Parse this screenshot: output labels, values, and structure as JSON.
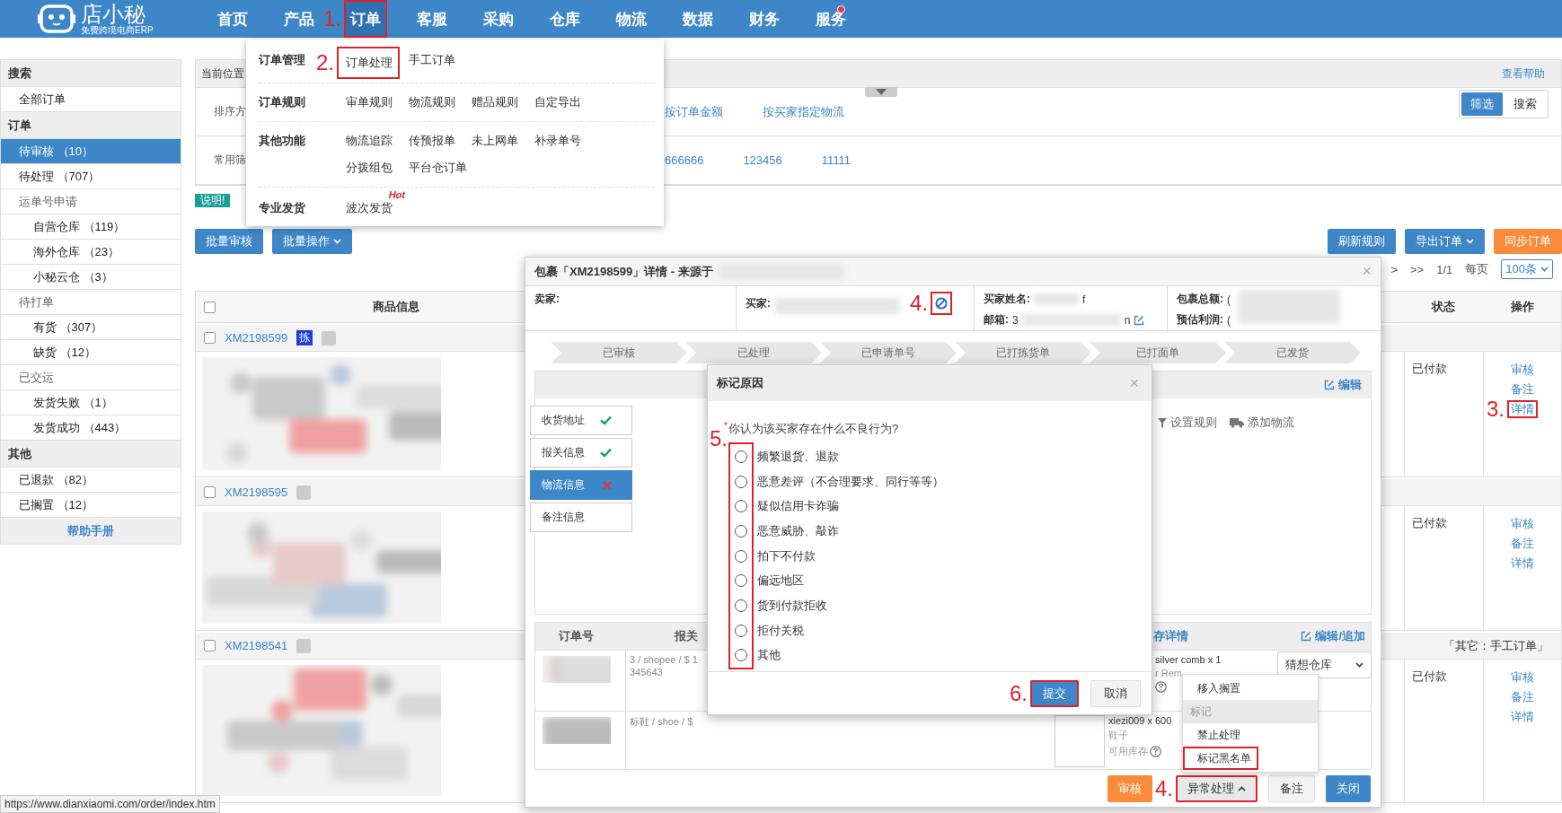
{
  "header": {
    "logo": "店小秘",
    "tagline": "免费跨境电商ERP",
    "nav": [
      {
        "label": "首页",
        "selected": false,
        "notice": false,
        "highlighted": false
      },
      {
        "label": "产品",
        "selected": false,
        "notice": false,
        "highlighted": false
      },
      {
        "label": "订单",
        "selected": true,
        "notice": false,
        "highlighted": true,
        "annotation": "1."
      },
      {
        "label": "客服",
        "selected": false,
        "notice": false,
        "highlighted": false
      },
      {
        "label": "采购",
        "selected": false,
        "notice": false,
        "highlighted": false
      },
      {
        "label": "仓库",
        "selected": false,
        "notice": false,
        "highlighted": false
      },
      {
        "label": "物流",
        "selected": false,
        "notice": false,
        "highlighted": false
      },
      {
        "label": "数据",
        "selected": false,
        "notice": false,
        "highlighted": false
      },
      {
        "label": "财务",
        "selected": false,
        "notice": false,
        "highlighted": false
      },
      {
        "label": "服务",
        "selected": false,
        "notice": true,
        "highlighted": false
      }
    ]
  },
  "order_menu": {
    "groups": [
      {
        "title": "订单管理",
        "links": [
          {
            "label": "订单处理",
            "highlighted": true,
            "annotation": "2."
          },
          {
            "label": "手工订单",
            "highlighted": false
          }
        ]
      },
      {
        "title": "订单规则",
        "links": [
          {
            "label": "审单规则",
            "highlighted": false
          },
          {
            "label": "物流规则",
            "highlighted": false
          },
          {
            "label": "赠品规则",
            "highlighted": false
          },
          {
            "label": "自定导出",
            "highlighted": false
          }
        ]
      },
      {
        "title": "其他功能",
        "links": [
          {
            "label": "物流追踪",
            "highlighted": false
          },
          {
            "label": "传预报单",
            "highlighted": false
          },
          {
            "label": "未上网单",
            "highlighted": false
          },
          {
            "label": "补录单号",
            "highlighted": false
          },
          {
            "label": "分拨组包",
            "highlighted": false
          },
          {
            "label": "平台仓订单",
            "highlighted": false
          }
        ]
      },
      {
        "title": "专业发货",
        "links": [
          {
            "label": "波次发货",
            "highlighted": false,
            "badge": "Hot"
          }
        ]
      }
    ]
  },
  "sidebar": {
    "sections": [
      {
        "title": "搜索",
        "items": [
          {
            "label": "全部订单",
            "selected": false
          }
        ]
      },
      {
        "title": "订单",
        "items": [
          {
            "label": "待审核 （10）",
            "selected": true
          },
          {
            "label": "待处理 （707）",
            "selected": false
          },
          {
            "label": "运单号申请",
            "selected": false,
            "children": [
              {
                "label": "自营仓库 （119）",
                "selected": false
              },
              {
                "label": "海外仓库 （23）",
                "selected": false
              },
              {
                "label": "小秘云仓 （3）",
                "selected": false
              }
            ]
          },
          {
            "label": "待打单",
            "selected": false,
            "children": [
              {
                "label": "有货 （307）",
                "selected": false
              },
              {
                "label": "缺货 （12）",
                "selected": false
              }
            ]
          },
          {
            "label": "已交运",
            "selected": false,
            "children": [
              {
                "label": "发货失败 （1）",
                "selected": false
              },
              {
                "label": "发货成功 （443）",
                "selected": false
              }
            ]
          }
        ]
      },
      {
        "title": "其他",
        "items": [
          {
            "label": "已退款 （82）",
            "selected": false
          },
          {
            "label": "已搁置 （12）",
            "selected": false
          }
        ]
      }
    ],
    "footer": "帮助手册"
  },
  "breadcrumb": {
    "label": "当前位置",
    "help": "查看帮助"
  },
  "filters": {
    "rows": [
      {
        "label": "排序方",
        "links": [
          "按订单金额",
          "按买家指定物流"
        ]
      },
      {
        "label": "常用筛",
        "links": [
          "666666",
          "123456",
          "11111"
        ]
      }
    ],
    "mode_toggle": [
      {
        "label": "筛选",
        "selected": true
      },
      {
        "label": "搜索",
        "selected": false
      }
    ]
  },
  "notice_badge": "说明!",
  "toolbar": {
    "left": [
      {
        "label": "批量审核",
        "kind": "primary"
      },
      {
        "label": "批量操作",
        "kind": "primary-dropdown"
      }
    ],
    "right": [
      {
        "label": "刷新规则",
        "kind": "primary"
      },
      {
        "label": "导出订单",
        "kind": "primary-dropdown"
      },
      {
        "label": "同步订单",
        "kind": "warning"
      }
    ]
  },
  "pagination": {
    "next": ">",
    "last": ">>",
    "page": "1/1",
    "per_page_label": "每页",
    "per_page": "100条"
  },
  "table": {
    "select_all_checked": false,
    "columns": [
      "商品信息",
      "状态",
      "操作"
    ],
    "rows": [
      {
        "checked": false,
        "order_no": "XM2198599",
        "pick_badge": "拣",
        "status": "已付款",
        "actions": [
          {
            "label": "审核",
            "highlighted": false
          },
          {
            "label": "备注",
            "highlighted": false
          },
          {
            "label": "详情",
            "highlighted": true,
            "annotation": "3."
          }
        ]
      },
      {
        "checked": false,
        "order_no": "XM2198595",
        "status": "已付款",
        "actions": [
          {
            "label": "审核",
            "highlighted": false
          },
          {
            "label": "备注",
            "highlighted": false
          },
          {
            "label": "详情",
            "highlighted": false
          }
        ]
      },
      {
        "checked": false,
        "order_no": "XM2198541",
        "note": "「其它：手工订单」",
        "status": "已付款",
        "actions": [
          {
            "label": "审核",
            "highlighted": false
          },
          {
            "label": "备注",
            "highlighted": false
          },
          {
            "label": "详情",
            "highlighted": false
          }
        ]
      }
    ]
  },
  "detail_dialog": {
    "title": "包裹「XM2198599」详情 - 来源于",
    "close": "×",
    "seller_label": "卖家:",
    "buyer_label": "买家:",
    "block_annotation": "4.",
    "block_highlighted": true,
    "buyer_name_label": "买家姓名:",
    "buyer_name_tail": "f",
    "email_label": "邮箱:",
    "email_head": "3",
    "email_tail": "n",
    "total_label": "包裹总额:",
    "total_head": "(",
    "profit_label": "预估利润:",
    "profit_head": "(",
    "steps": [
      "已审核",
      "已处理",
      "已申请单号",
      "已打拣货单",
      "已打面单",
      "已发货"
    ],
    "edit": "编辑",
    "info_tabs": [
      {
        "label": "收货地址",
        "kind": "ok",
        "selected": false
      },
      {
        "label": "报关信息",
        "kind": "ok",
        "selected": false
      },
      {
        "label": "物流信息",
        "kind": "error",
        "selected": true
      },
      {
        "label": "备注信息",
        "kind": "plain",
        "selected": false
      }
    ],
    "logistics_actions": [
      {
        "label": "设置规则",
        "kind": "filter"
      },
      {
        "label": "添加物流",
        "kind": "truck"
      }
    ],
    "items_columns": [
      "订单号",
      "报关"
    ],
    "stock_title": "存详情",
    "edit_add": "编辑/追加",
    "items": [
      {
        "kind": "covered",
        "desc": "3 / shopee / $ 1",
        "desc2": "345643",
        "lines": [
          "silver comb x 1",
          "r Rem"
        ],
        "warehouse": "猜想仓库"
      },
      {
        "kind": "full",
        "desc": "标鞋 / shoe / $",
        "lines": [
          "xiezi009 x 600",
          "鞋子"
        ],
        "stock_label": "可用库存"
      }
    ],
    "footer_buttons": [
      {
        "label": "审核",
        "kind": "warning",
        "highlighted": false
      },
      {
        "label": "异常处理",
        "kind": "menu",
        "expanded": true,
        "highlighted": true,
        "annotation": "4."
      },
      {
        "label": "备注",
        "kind": "default",
        "highlighted": false
      },
      {
        "label": "关闭",
        "kind": "primary",
        "highlighted": false
      }
    ],
    "exception_menu": [
      {
        "label": "移入搁置",
        "kind": "item",
        "highlighted": false
      },
      {
        "label": "标记",
        "kind": "header",
        "highlighted": false
      },
      {
        "label": "禁止处理",
        "kind": "item",
        "highlighted": false
      },
      {
        "label": "标记黑名单",
        "kind": "item",
        "highlighted": true
      }
    ]
  },
  "mark_modal": {
    "title": "标记原因",
    "close": "×",
    "required_mark": "*",
    "question": "你认为该买家存在什么不良行为?",
    "annotation": "5.",
    "options_highlighted": true,
    "options": [
      {
        "label": "频繁退货、退款",
        "selected": false
      },
      {
        "label": "恶意差评（不合理要求、同行等等）",
        "selected": false
      },
      {
        "label": "疑似信用卡诈骗",
        "selected": false
      },
      {
        "label": "恶意威胁、敲诈",
        "selected": false
      },
      {
        "label": "拍下不付款",
        "selected": false
      },
      {
        "label": "偏远地区",
        "selected": false
      },
      {
        "label": "货到付款拒收",
        "selected": false
      },
      {
        "label": "拒付关税",
        "selected": false
      },
      {
        "label": "其他",
        "selected": false
      }
    ],
    "buttons": [
      {
        "label": "提交",
        "kind": "primary",
        "highlighted": true,
        "annotation": "6."
      },
      {
        "label": "取消",
        "kind": "default",
        "highlighted": false
      }
    ]
  },
  "status_url": "https://www.dianxiaomi.com/order/index.htm"
}
